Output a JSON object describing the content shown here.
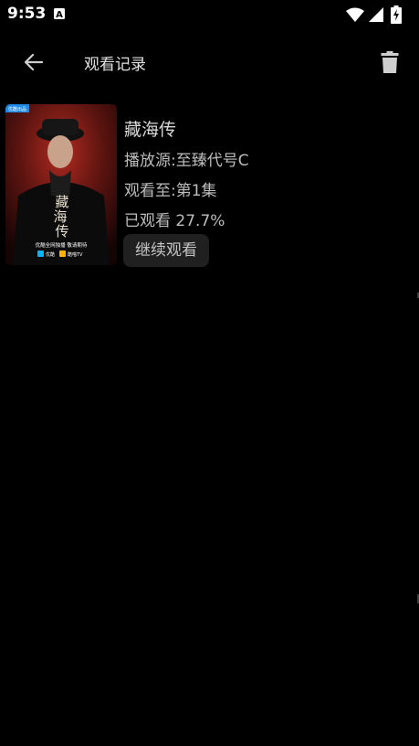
{
  "status_bar": {
    "time": "9:53",
    "notification_icon": "a-badge-icon",
    "wifi_icon": "wifi-icon",
    "signal_icon": "signal-icon",
    "battery_icon": "battery-charging-icon"
  },
  "header": {
    "back_icon": "arrow-left-icon",
    "title": "观看记录",
    "delete_icon": "trash-icon"
  },
  "history": [
    {
      "title": "藏海传",
      "source": "播放源:至臻代号C",
      "watched_to": "观看至:第1集",
      "progress_text": "已观看 27.7%",
      "progress": 0.277,
      "continue_label": "继续观看",
      "poster": {
        "badge": "优酷出品",
        "calligraphy": "藏海传",
        "slogan": "优酷全网独播 敬请期待",
        "platform_a": "优酷",
        "platform_b": "酷喵TV"
      }
    }
  ]
}
